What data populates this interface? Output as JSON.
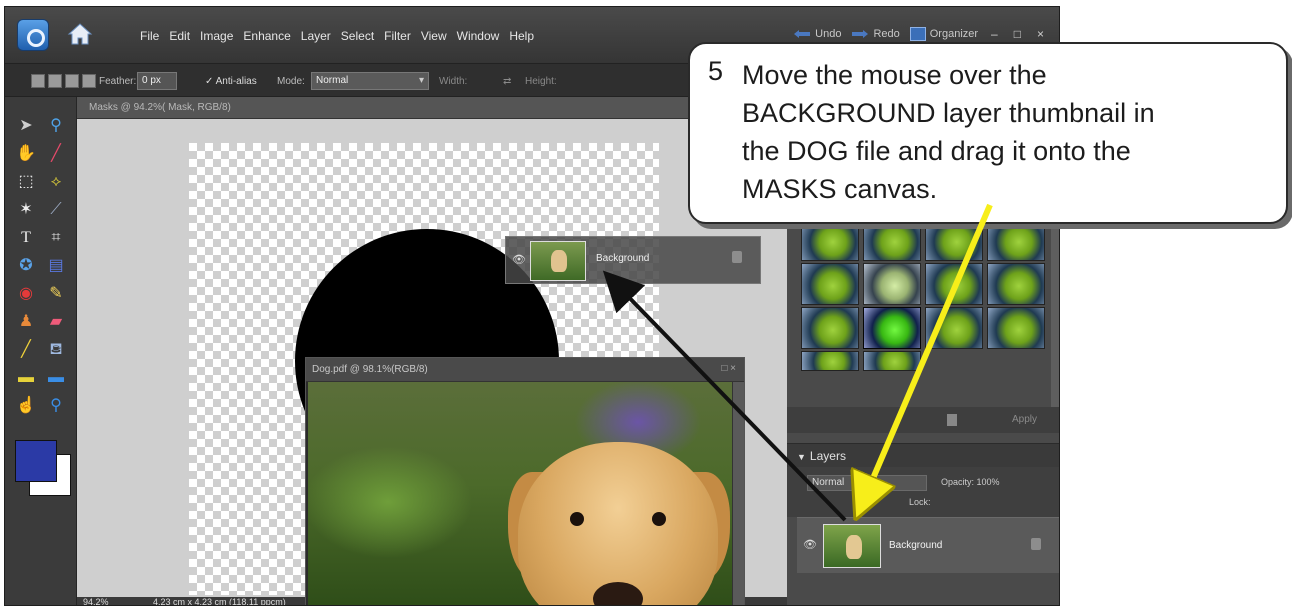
{
  "menubar": {
    "items": [
      "File",
      "Edit",
      "Image",
      "Enhance",
      "Layer",
      "Select",
      "Filter",
      "View",
      "Window",
      "Help"
    ],
    "undo_label": "Undo",
    "redo_label": "Redo",
    "organizer_label": "Organizer"
  },
  "options": {
    "feather_label": "Feather:",
    "feather_value": "0 px",
    "antialias_label": "Anti-alias",
    "mode_label": "Mode:",
    "mode_value": "Normal",
    "width_label": "Width:",
    "height_label": "Height:"
  },
  "masks_doc": {
    "title": "Masks @ 94.2%( Mask, RGB/8)",
    "zoom": "94.2%",
    "size_info": "4.23 cm x 4.23 cm (118.11 ppcm)"
  },
  "drag_layer": {
    "name": "Background"
  },
  "dog_doc": {
    "title": "Dog.pdf @ 98.1%(RGB/8)"
  },
  "effects": {
    "apply_label": "Apply"
  },
  "layers_panel": {
    "header": "Layers",
    "blend_mode": "Normal",
    "opacity_label": "Opacity:",
    "opacity_value": "100%",
    "lock_label": "Lock:",
    "layer_name": "Background"
  },
  "callout": {
    "step": "5",
    "lines": [
      "Move the mouse over the",
      "BACKGROUND layer thumbnail in",
      "the DOG file and drag it onto the",
      "MASKS canvas."
    ]
  },
  "colors": {
    "foreground": "#2b3aa6",
    "background": "#ffffff",
    "arrow_black": "#111111",
    "arrow_yellow": "#f7ee1a"
  }
}
